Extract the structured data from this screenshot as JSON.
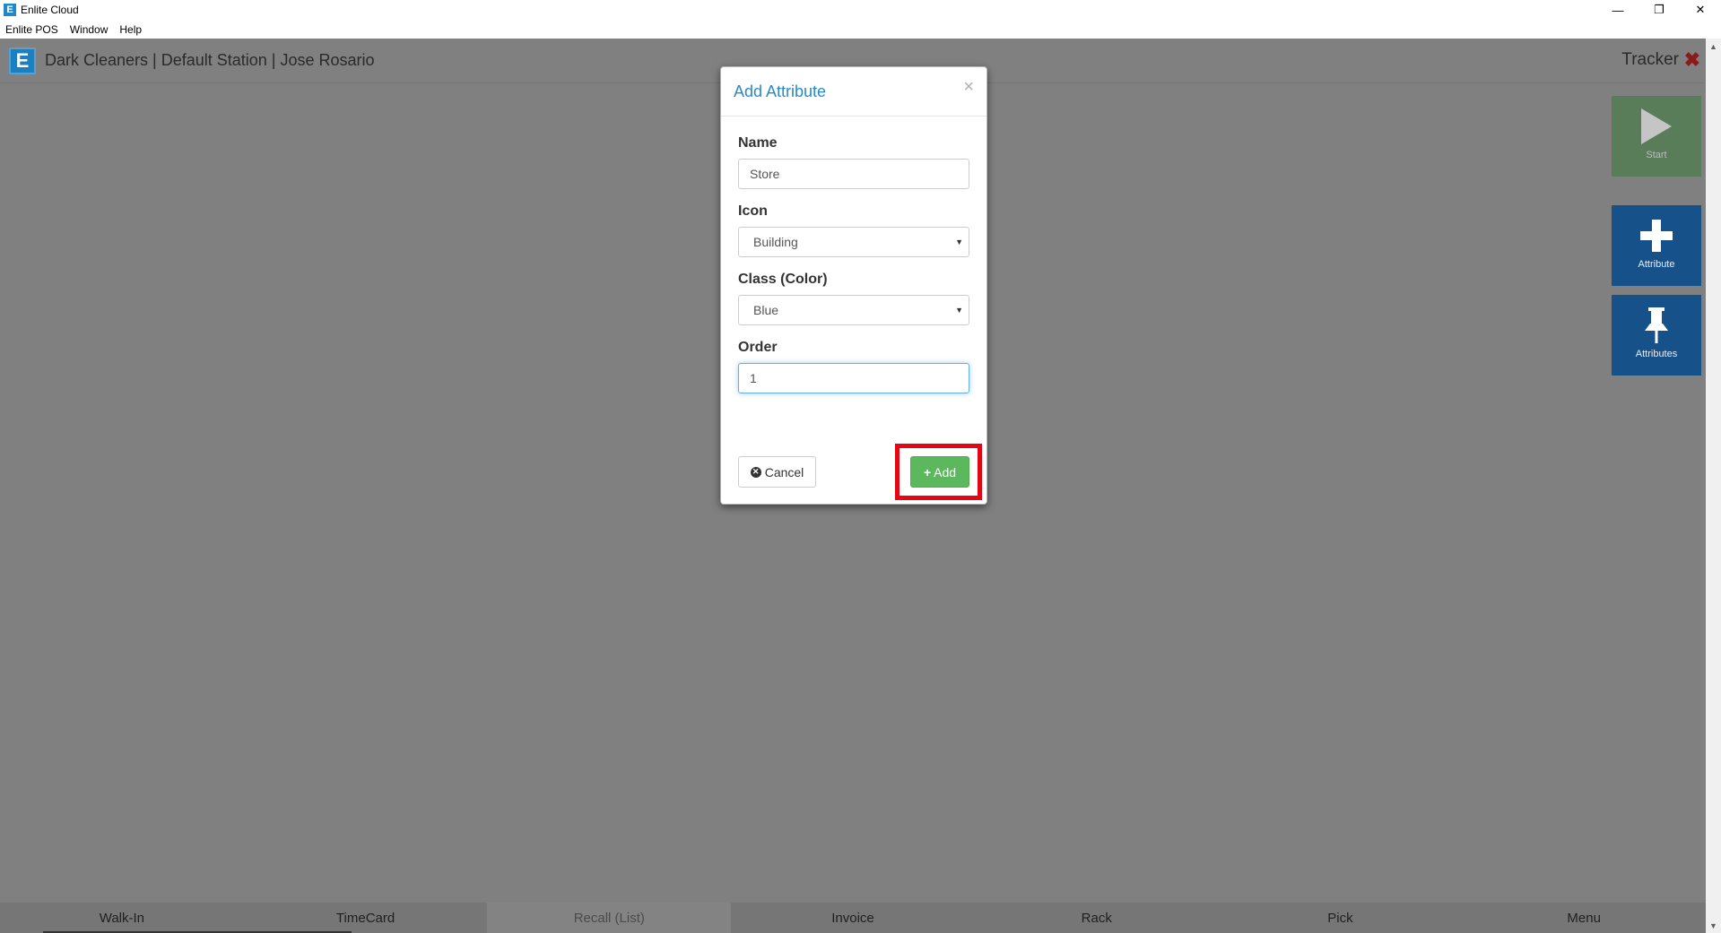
{
  "window": {
    "logo_letter": "E",
    "title": "Enlite Cloud",
    "minimize": "—",
    "restore": "❐",
    "close": "✕"
  },
  "menu": [
    "Enlite POS",
    "Window",
    "Help"
  ],
  "header": {
    "logo_letter": "E",
    "title": "Dark Cleaners | Default Station | Jose Rosario",
    "tracker": "Tracker",
    "close_glyph": "✖"
  },
  "tiles": {
    "start": {
      "label": "Start",
      "icon": "play-icon"
    },
    "attribute": {
      "label": "Attribute",
      "icon": "plus-icon"
    },
    "attributes": {
      "label": "Attributes",
      "icon": "pushpin-icon"
    }
  },
  "modal": {
    "title": "Add Attribute",
    "close": "×",
    "name_label": "Name",
    "name_value": "Store",
    "icon_label": "Icon",
    "icon_value": "Building",
    "class_label": "Class (Color)",
    "class_value": "Blue",
    "order_label": "Order",
    "order_value": "1",
    "cancel_label": "Cancel",
    "add_label": "Add",
    "highlight_color": "#e30613",
    "add_color": "#5cb85c"
  },
  "bottom_nav": [
    "Walk-In",
    "TimeCard",
    "Recall (List)",
    "Invoice",
    "Rack",
    "Pick",
    "Menu"
  ],
  "colors": {
    "overlay": "#808080",
    "tile_blue": "#17518a",
    "tile_green": "#3b7a3b",
    "title_blue": "#2a8ac8"
  }
}
